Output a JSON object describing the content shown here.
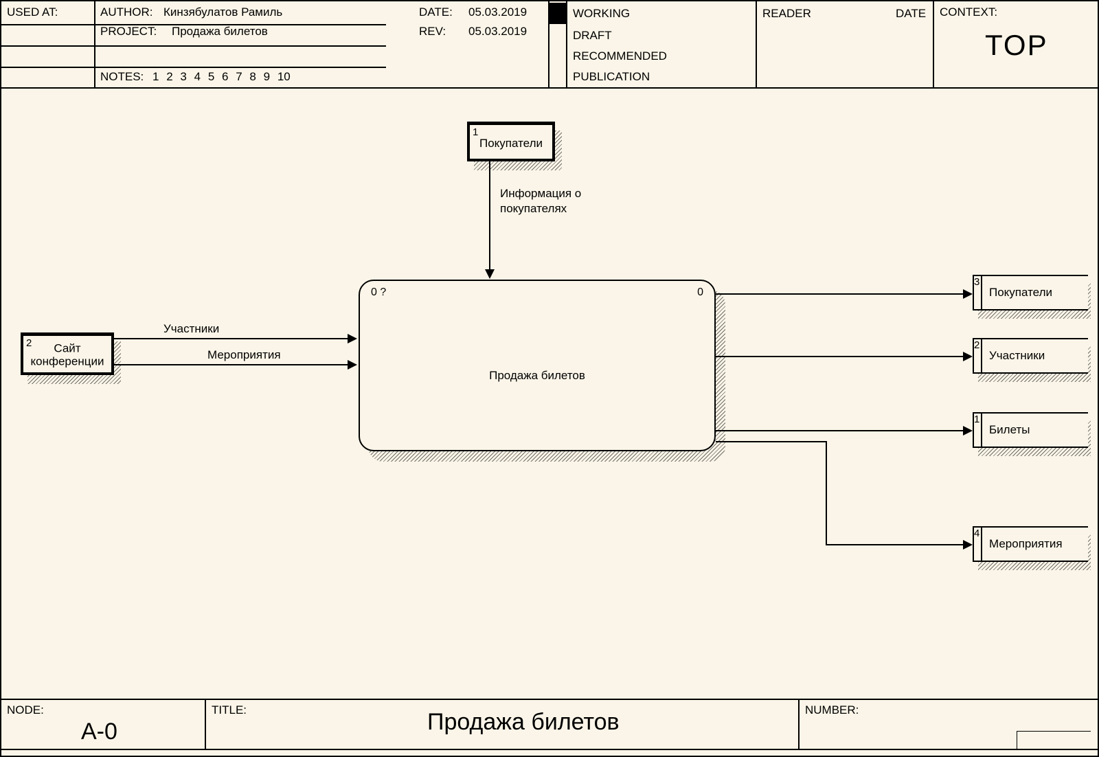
{
  "header": {
    "used_at_label": "USED AT:",
    "author_label": "AUTHOR:",
    "author_value": "Кинзябулатов Рамиль",
    "project_label": "PROJECT:",
    "project_value": "Продажа билетов",
    "date_label": "DATE:",
    "date_value": "05.03.2019",
    "rev_label": "REV:",
    "rev_value": "05.03.2019",
    "notes_label": "NOTES:",
    "notes": [
      "1",
      "2",
      "3",
      "4",
      "5",
      "6",
      "7",
      "8",
      "9",
      "10"
    ],
    "status": {
      "working": "WORKING",
      "draft": "DRAFT",
      "recommended": "RECOMMENDED",
      "publication": "PUBLICATION"
    },
    "reader_label": "READER",
    "reader_date_label": "DATE",
    "context_label": "CONTEXT:",
    "context_value": "TOP"
  },
  "blocks": {
    "buyers": {
      "num": "1",
      "label": "Покупатели"
    },
    "site": {
      "num": "2",
      "label_line1": "Сайт",
      "label_line2": "конференции"
    },
    "process": {
      "corner_left": "0 ?",
      "corner_right": "0",
      "label": "Продажа билетов"
    }
  },
  "arrows": {
    "info_buyers_line1": "Информация о",
    "info_buyers_line2": "покупателях",
    "participants": "Участники",
    "events": "Мероприятия"
  },
  "outputs": {
    "buyers": {
      "num": "3",
      "label": "Покупатели"
    },
    "participants": {
      "num": "2",
      "label": "Участники"
    },
    "tickets": {
      "num": "1",
      "label": "Билеты"
    },
    "events": {
      "num": "4",
      "label": "Мероприятия"
    }
  },
  "footer": {
    "node_label": "NODE:",
    "node_value": "A-0",
    "title_label": "TITLE:",
    "title_value": "Продажа билетов",
    "number_label": "NUMBER:"
  }
}
